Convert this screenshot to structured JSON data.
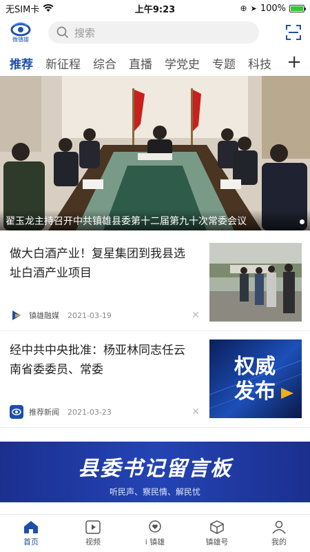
{
  "status": {
    "carrier": "无SIM卡",
    "time": "上午9:23",
    "battery": "100%"
  },
  "search": {
    "placeholder": "搜索"
  },
  "logo": {
    "text": "微镇雄"
  },
  "tabs": [
    "推荐",
    "新征程",
    "综合",
    "直播",
    "学党史",
    "专题",
    "科技"
  ],
  "tab_plus": "+",
  "banner": {
    "caption": "翟玉龙主持召开中共镇雄县委第十二届第九十次常委会议"
  },
  "news": [
    {
      "title": "做大白酒产业！复星集团到我县选址白酒产业项目",
      "source": "镇雄融媒",
      "date": "2021-03-19"
    },
    {
      "title": "经中共中央批准：杨亚林同志任云南省委委员、常委",
      "source": "推荐新闻",
      "date": "2021-03-23",
      "thumb_text": "权威\n发布"
    }
  ],
  "ad": {
    "title": "县委书记留言板",
    "subtitle": "听民声、察民情、解民忧"
  },
  "tabbar": [
    "首页",
    "视频",
    "i 镇雄",
    "镇雄号",
    "我的"
  ],
  "colors": {
    "accent": "#1e4fa8"
  }
}
